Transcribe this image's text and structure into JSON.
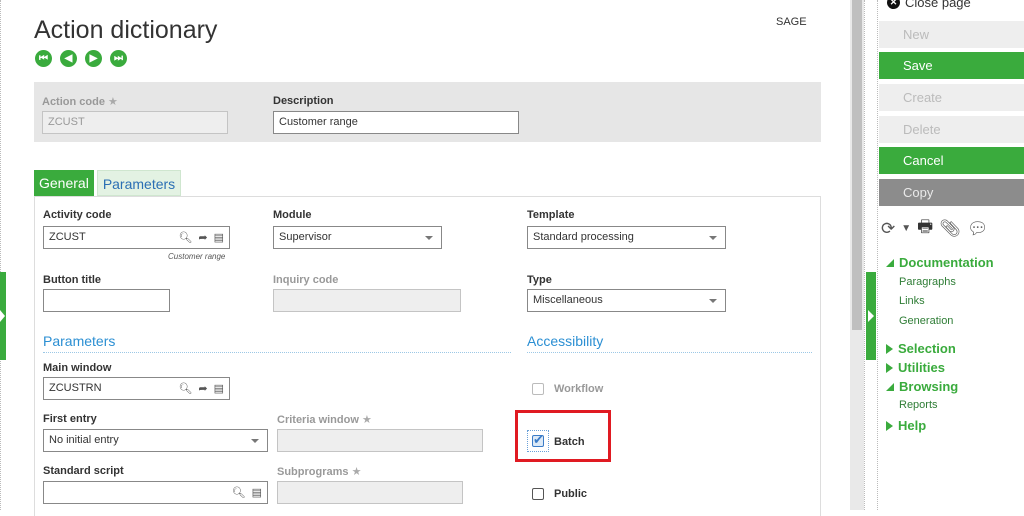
{
  "page": {
    "title": "Action dictionary",
    "user": "SAGE"
  },
  "nav": {
    "first": "|◀",
    "prev": "◀",
    "next": "▶",
    "last": "▶|"
  },
  "header": {
    "action_code_label": "Action code",
    "action_code_value": "ZCUST",
    "description_label": "Description",
    "description_value": "Customer range"
  },
  "tabs": [
    "General",
    "Parameters"
  ],
  "general": {
    "activity_code_label": "Activity code",
    "activity_code_value": "ZCUST",
    "activity_code_hint": "Customer range",
    "module_label": "Module",
    "module_value": "Supervisor",
    "template_label": "Template",
    "template_value": "Standard processing",
    "button_title_label": "Button title",
    "button_title_value": "",
    "inquiry_code_label": "Inquiry code",
    "inquiry_code_value": "",
    "type_label": "Type",
    "type_value": "Miscellaneous"
  },
  "parameters": {
    "section_title": "Parameters",
    "main_window_label": "Main window",
    "main_window_value": "ZCUSTRN",
    "first_entry_label": "First entry",
    "first_entry_value": "No initial entry",
    "criteria_window_label": "Criteria window",
    "standard_script_label": "Standard script",
    "standard_script_value": "",
    "subprograms_label": "Subprograms"
  },
  "accessibility": {
    "section_title": "Accessibility",
    "workflow_label": "Workflow",
    "workflow_checked": false,
    "batch_label": "Batch",
    "batch_checked": true,
    "public_label": "Public",
    "public_checked": false
  },
  "actions": {
    "close_page": "Close page",
    "new": "New",
    "save": "Save",
    "create": "Create",
    "delete": "Delete",
    "cancel": "Cancel",
    "copy": "Copy"
  },
  "menu": {
    "documentation": "Documentation",
    "doc_items": [
      "Paragraphs",
      "Links",
      "Generation"
    ],
    "selection": "Selection",
    "utilities": "Utilities",
    "browsing": "Browsing",
    "browsing_items": [
      "Reports"
    ],
    "help": "Help"
  },
  "colors": {
    "accent": "#3aab3d",
    "link": "#2b8fd3",
    "highlight": "#e01a22"
  }
}
